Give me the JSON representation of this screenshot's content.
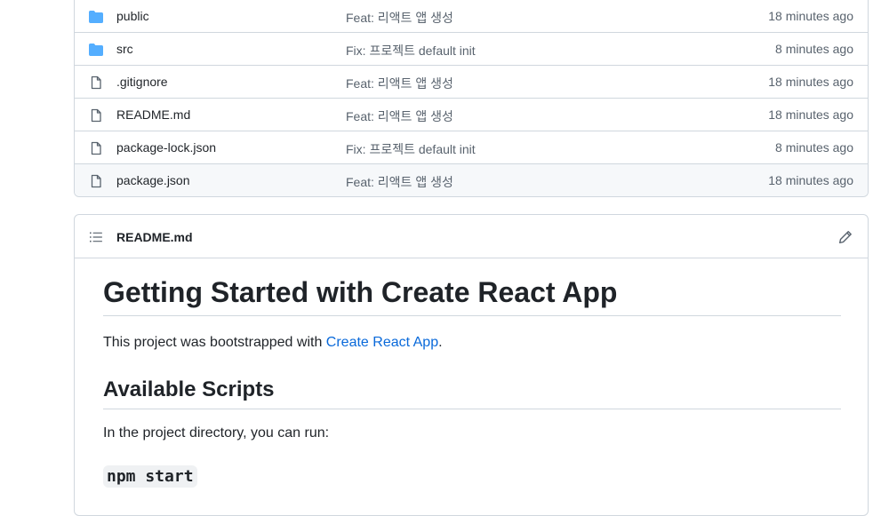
{
  "files": [
    {
      "name": "public",
      "type": "folder",
      "message": "Feat: 리액트 앱 생성",
      "age": "18 minutes ago"
    },
    {
      "name": "src",
      "type": "folder",
      "message": "Fix: 프로젝트 default init",
      "age": "8 minutes ago"
    },
    {
      "name": ".gitignore",
      "type": "file",
      "message": "Feat: 리액트 앱 생성",
      "age": "18 minutes ago"
    },
    {
      "name": "README.md",
      "type": "file",
      "message": "Feat: 리액트 앱 생성",
      "age": "18 minutes ago"
    },
    {
      "name": "package-lock.json",
      "type": "file",
      "message": "Fix: 프로젝트 default init",
      "age": "8 minutes ago"
    },
    {
      "name": "package.json",
      "type": "file",
      "message": "Feat: 리액트 앱 생성",
      "age": "18 minutes ago"
    }
  ],
  "readme": {
    "header_title": "README.md",
    "h1": "Getting Started with Create React App",
    "intro_prefix": "This project was bootstrapped with ",
    "intro_link": "Create React App",
    "intro_suffix": ".",
    "h2": "Available Scripts",
    "run_text": "In the project directory, you can run:",
    "h3_code": "npm start"
  },
  "colors": {
    "folder": "#54aeff",
    "file_icon": "#59636e",
    "link": "#0969da",
    "border": "#d0d7de"
  },
  "icons": {
    "folder": "folder-icon",
    "file": "file-icon",
    "list": "list-unordered-icon",
    "edit": "pencil-icon"
  }
}
